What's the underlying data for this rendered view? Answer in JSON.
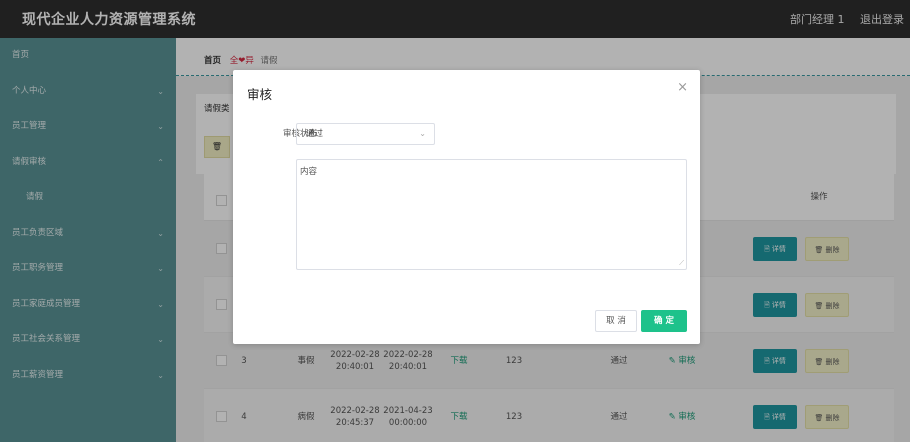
{
  "header": {
    "app_title": "现代企业人力资源管理系统",
    "user_label": "部门经理 1",
    "logout_label": "退出登录"
  },
  "sidebar": {
    "items": [
      {
        "label": "首页",
        "chevron": ""
      },
      {
        "label": "个人中心",
        "chevron": "⌄"
      },
      {
        "label": "员工管理",
        "chevron": "⌄"
      },
      {
        "label": "请假审核",
        "chevron": "⌃"
      },
      {
        "label": "请假",
        "chevron": ""
      },
      {
        "label": "员工负责区域",
        "chevron": "⌄"
      },
      {
        "label": "员工职务管理",
        "chevron": "⌄"
      },
      {
        "label": "员工家庭成员管理",
        "chevron": "⌄"
      },
      {
        "label": "员工社会关系管理",
        "chevron": "⌄"
      },
      {
        "label": "员工薪资管理",
        "chevron": "⌄"
      }
    ]
  },
  "breadcrumb": {
    "home": "首页",
    "fav": "全❤异",
    "current": "请假"
  },
  "filter": {
    "label": "请假类",
    "button_icon": "🗑"
  },
  "table": {
    "ops_header": "操作",
    "detail_label": "🗎 详情",
    "delete_label": "🗑 删除",
    "rows": [
      {
        "id": "",
        "type": "",
        "start": "",
        "end": "",
        "file": "",
        "days": "",
        "status": "",
        "review": ""
      },
      {
        "id": "",
        "type": "",
        "start": "",
        "end": "",
        "file": "",
        "days": "",
        "status": "",
        "review": ""
      },
      {
        "id": "3",
        "type": "事假",
        "start": "2022-02-28 20:40:01",
        "end": "2022-02-28 20:40:01",
        "file": "下载",
        "days": "123",
        "status": "通过",
        "review": "✎ 审核"
      },
      {
        "id": "4",
        "type": "病假",
        "start": "2022-02-28 20:45:37",
        "end": "2021-04-23 00:00:00",
        "file": "下载",
        "days": "123",
        "status": "通过",
        "review": "✎ 审核"
      }
    ]
  },
  "dialog": {
    "title": "审核",
    "close": "×",
    "status_label": "审核状态",
    "status_value": "通过",
    "content_label": "内容",
    "content_value": "",
    "cancel_label": "取 消",
    "ok_label": "确 定"
  },
  "colors": {
    "topbar": "#2f2f2f",
    "sidebar": "#5a9296",
    "accent": "#1f97a1",
    "ok_button": "#1ec28b"
  }
}
